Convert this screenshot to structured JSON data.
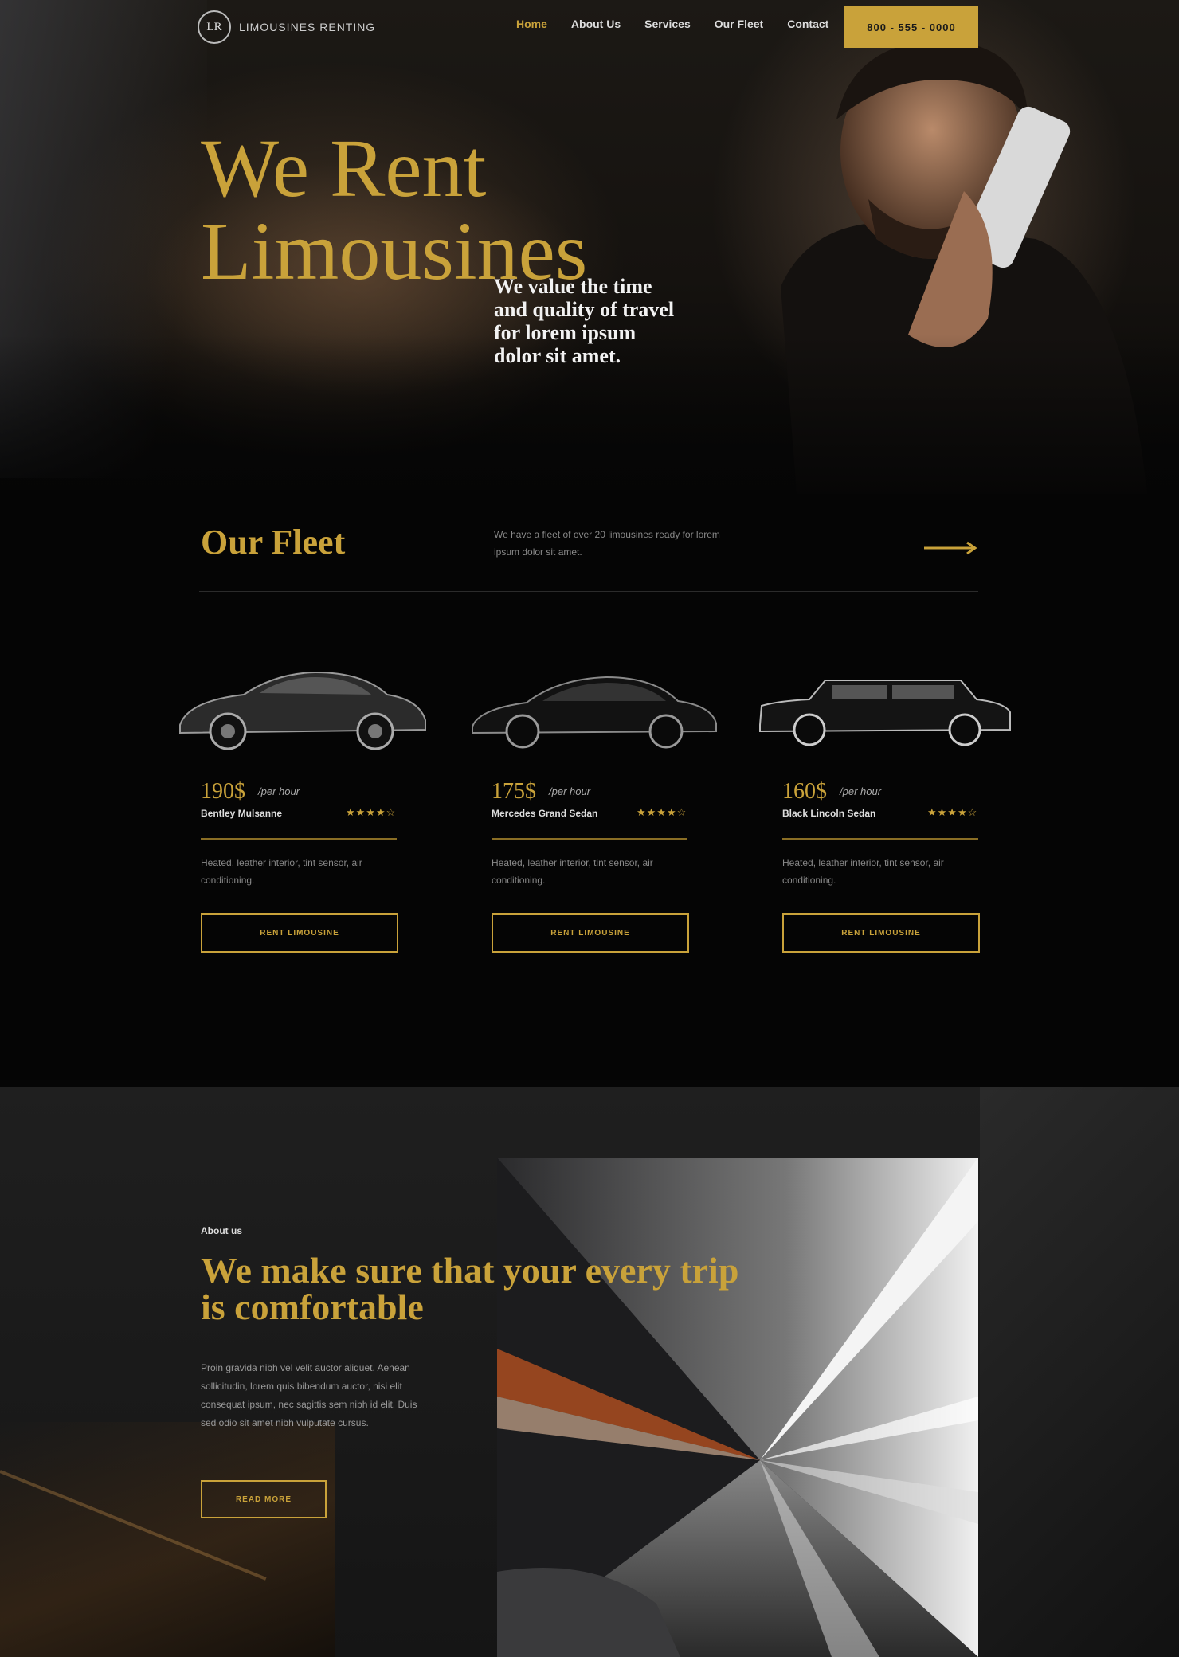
{
  "nav": {
    "logo_initials": "LR",
    "logo_text": "LIMOUSINES RENTING",
    "links": [
      "Home",
      "About Us",
      "Services",
      "Our Fleet",
      "Contact"
    ],
    "phone": "800 - 555 - 0000"
  },
  "hero": {
    "title_line1": "We Rent",
    "title_line2": "Limousines",
    "subtitle": "We value the time and quality of travel for lorem ipsum dolor sit amet."
  },
  "fleet": {
    "title": "Our Fleet",
    "description": "We have a fleet of over 20 limousines ready for lorem ipsum dolor sit amet.",
    "cards": [
      {
        "price": "190$",
        "per": "/per hour",
        "name": "Bentley Mulsanne",
        "stars": "★★★★☆",
        "desc": "Heated, leather interior, tint sensor, air conditioning.",
        "button": "RENT LIMOUSINE"
      },
      {
        "price": "175$",
        "per": "/per hour",
        "name": "Mercedes Grand Sedan",
        "stars": "★★★★☆",
        "desc": "Heated, leather interior, tint sensor, air conditioning.",
        "button": "RENT LIMOUSINE"
      },
      {
        "price": "160$",
        "per": "/per hour",
        "name": "Black Lincoln Sedan",
        "stars": "★★★★☆",
        "desc": "Heated, leather interior, tint sensor, air conditioning.",
        "button": "RENT LIMOUSINE"
      }
    ]
  },
  "about": {
    "label": "About us",
    "title": "We make sure that your every trip is comfortable",
    "text": "Proin gravida nibh vel velit auctor aliquet. Aenean sollicitudin, lorem quis bibendum auctor, nisi elit consequat ipsum, nec sagittis sem nibh id elit. Duis sed odio sit amet nibh vulputate cursus.",
    "button": "READ MORE"
  },
  "colors": {
    "accent": "#c9a23a",
    "background": "#050505",
    "section": "#1b1b1b"
  }
}
